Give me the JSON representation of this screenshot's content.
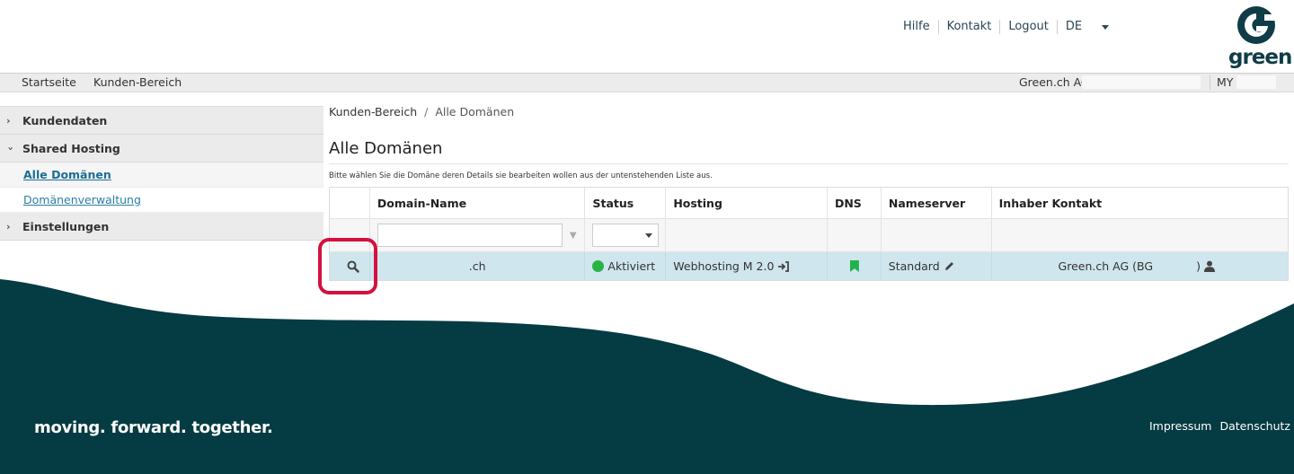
{
  "header": {
    "links": [
      "Hilfe",
      "Kontakt",
      "Logout"
    ],
    "language": "DE",
    "logo_text": "green"
  },
  "subbar": {
    "left": [
      "Startseite",
      "Kunden-Bereich"
    ],
    "company": "Green.ch AG",
    "user": "MY"
  },
  "sidebar": {
    "groups": [
      {
        "label": "Kundendaten",
        "expanded": false
      },
      {
        "label": "Shared Hosting",
        "expanded": true,
        "items": [
          {
            "label": "Alle Domänen",
            "active": true
          },
          {
            "label": "Domänenverwaltung",
            "active": false
          }
        ]
      },
      {
        "label": "Einstellungen",
        "expanded": false
      }
    ]
  },
  "breadcrumb": {
    "parent": "Kunden-Bereich",
    "separator": "/",
    "current": "Alle Domänen"
  },
  "page_title": "Alle Domänen",
  "hint": "Bitte wählen Sie die Domäne deren Details sie bearbeiten wollen aus der untenstehenden Liste aus.",
  "table": {
    "columns": [
      "",
      "Domain-Name",
      "Status",
      "Hosting",
      "DNS",
      "Nameserver",
      "Inhaber Kontakt"
    ],
    "filter": {
      "domain_value": "",
      "status_value": ""
    },
    "rows": [
      {
        "domain": ".ch",
        "status": "Aktiviert",
        "hosting": "Webhosting M 2.0",
        "nameserver": "Standard",
        "owner": "Green.ch AG (BG",
        "owner_end": ")"
      }
    ]
  },
  "footer": {
    "slogan": "moving. forward. together.",
    "links": [
      "Impressum",
      "Datenschutz"
    ]
  },
  "colors": {
    "brand_dark": "#0f3c47",
    "footer_bg": "#053b42",
    "status_green": "#2ab345",
    "row_highlight": "#cfe6ee",
    "annotation_red": "#d5103f"
  }
}
